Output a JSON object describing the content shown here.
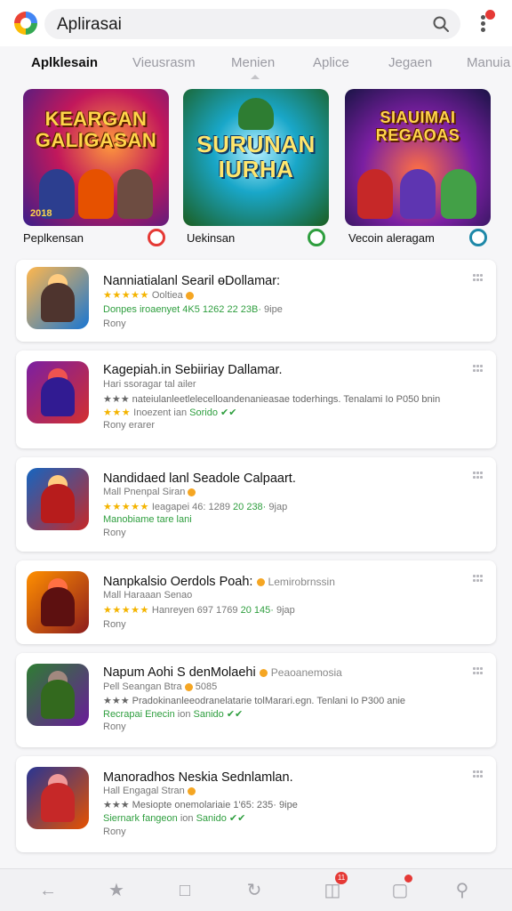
{
  "search": {
    "query": "Aplirasai"
  },
  "tabs": [
    "Aplklesain",
    "Vieusrasm",
    "Menien",
    "Aplice",
    "Jegaen",
    "Manuia"
  ],
  "featured": [
    {
      "art_title": "KEARGAN GALIGASAN",
      "art_corner": "2018",
      "label": "Peplkensan",
      "badge_color": "#e53935"
    },
    {
      "art_title": "SURUNAN IURHA",
      "art_corner": "",
      "label": "Uekinsan",
      "badge_color": "#2e9e3e"
    },
    {
      "art_title": "SIAUIMAI REGAOAS",
      "art_corner": "",
      "label": "Vecoin aleragam",
      "badge_color": "#1e88a8"
    }
  ],
  "apps": [
    {
      "title": "Nanniatialanl Searil ɵDollamar:",
      "line1_stars": "★★★★★",
      "line1_text": "Ooltiea",
      "line2_muted": "Donpes iroaenyet 4K5 1262",
      "line2_green": "22 23B·",
      "line2_tail": "9ipe",
      "line3": "Rony"
    },
    {
      "title": "Kagepiah.in Sebiiriay Dallamar.",
      "line1_stars": "",
      "line1_text": "Hari ssoragar tal ailer",
      "line2_muted": "★★★ nateiulanleetlelecelloandenanieasae toderhings. Tenalami Io P050 bnin",
      "line2_green": "",
      "line2_tail": "",
      "line3_stars": "★★★",
      "line3_text": "Inoezent ian",
      "line3_green": "Sorido ✔✔",
      "line4": "Rony   erarer"
    },
    {
      "title": "Nandidaed lanl Seadole Calpaart.",
      "line1_stars": "",
      "line1_text": "Mall Pnenpal Siran",
      "line2_muted": "Ieagapei 46: 1289",
      "line2_green": "20 238·",
      "line2_tail": "9jap",
      "line2_stars": "★★★★★",
      "line3": "Manobiame tare lani",
      "line4": "Rony"
    },
    {
      "title": "Nanpkalsio Oerdols Poah:",
      "title_tail": "Lemirobrnssin",
      "line1_stars": "",
      "line1_text": "Mall Haraaan Senao",
      "line2_muted": "Hanreyen 697 1769",
      "line2_green": "20 145·",
      "line2_tail": "9jap",
      "line2_stars": "★★★★★",
      "line3": "Rony"
    },
    {
      "title": "Napum Aohi S denMolaehi",
      "title_tail": "Peaoanemosia",
      "line1_stars": "",
      "line1_text": "Pell Seangan Btra",
      "line1_tail": "5085",
      "line2_muted": "★★★ Pradokinanleeodranelatarie tolMarari.egn. Tenlani Io P300 anie",
      "line2_green": "",
      "line2_tail": "",
      "line3_green_full": "Recrapai Enecin",
      "line3_text": "ion",
      "line3_green": "Sanido ✔✔",
      "line4": "Rony"
    },
    {
      "title": "Manoradhos Neskia Sednlamlan.",
      "line1_stars": "",
      "line1_text": "Hall Engagal Stran",
      "line2_muted": "★★★ Mesiopte onemolariaie 1'65: 235·",
      "line2_green": "",
      "line2_tail": "9ipe",
      "line3_green_full": "Siernark fangeon",
      "line3_text": "ion",
      "line3_green": "Sanido ✔✔",
      "line4": "Rony"
    }
  ],
  "bottom_nav": {
    "badge_count": "11"
  },
  "colors": {
    "accent": "#e53935",
    "star": "#f4b400",
    "green": "#2e9e3e",
    "muted": "#9a9aa2"
  }
}
